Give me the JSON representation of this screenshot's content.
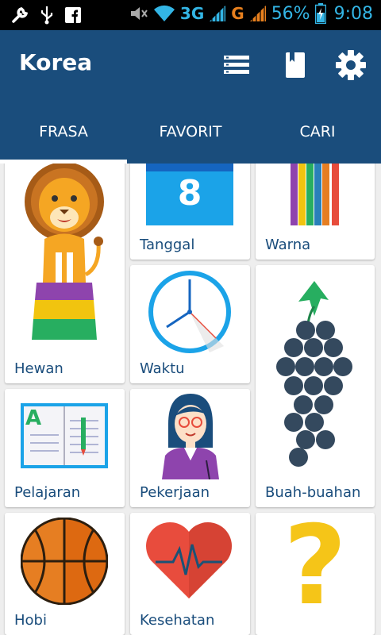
{
  "status_bar": {
    "network_3g": "3G",
    "network_g": "G",
    "battery": "56%",
    "time": "9:08",
    "icons_left": [
      "wrench-icon",
      "usb-icon",
      "facebook-icon"
    ],
    "icons_right": [
      "mute-icon",
      "wifi-icon",
      "signal-icon",
      "signal-icon-2",
      "battery-icon"
    ]
  },
  "app_bar": {
    "title": "Korea",
    "actions": [
      "list-icon",
      "book-icon",
      "settings-icon"
    ],
    "colors": {
      "primary": "#1a4d7c",
      "accent": "#ffffff"
    }
  },
  "tabs": [
    {
      "label": "FRASA",
      "selected": true
    },
    {
      "label": "FAVORIT",
      "selected": false
    },
    {
      "label": "CARI",
      "selected": false
    }
  ],
  "categories": {
    "hewan": "Hewan",
    "tanggal": "Tanggal",
    "warna": "Warna",
    "waktu": "Waktu",
    "buah": "Buah-buahan",
    "pelajaran": "Pelajaran",
    "pekerjaan": "Pekerjaan",
    "hobi": "Hobi",
    "kesehatan": "Kesehatan",
    "calendar_day": "8",
    "notebook_letter": "A",
    "unknown_symbol": "?"
  }
}
